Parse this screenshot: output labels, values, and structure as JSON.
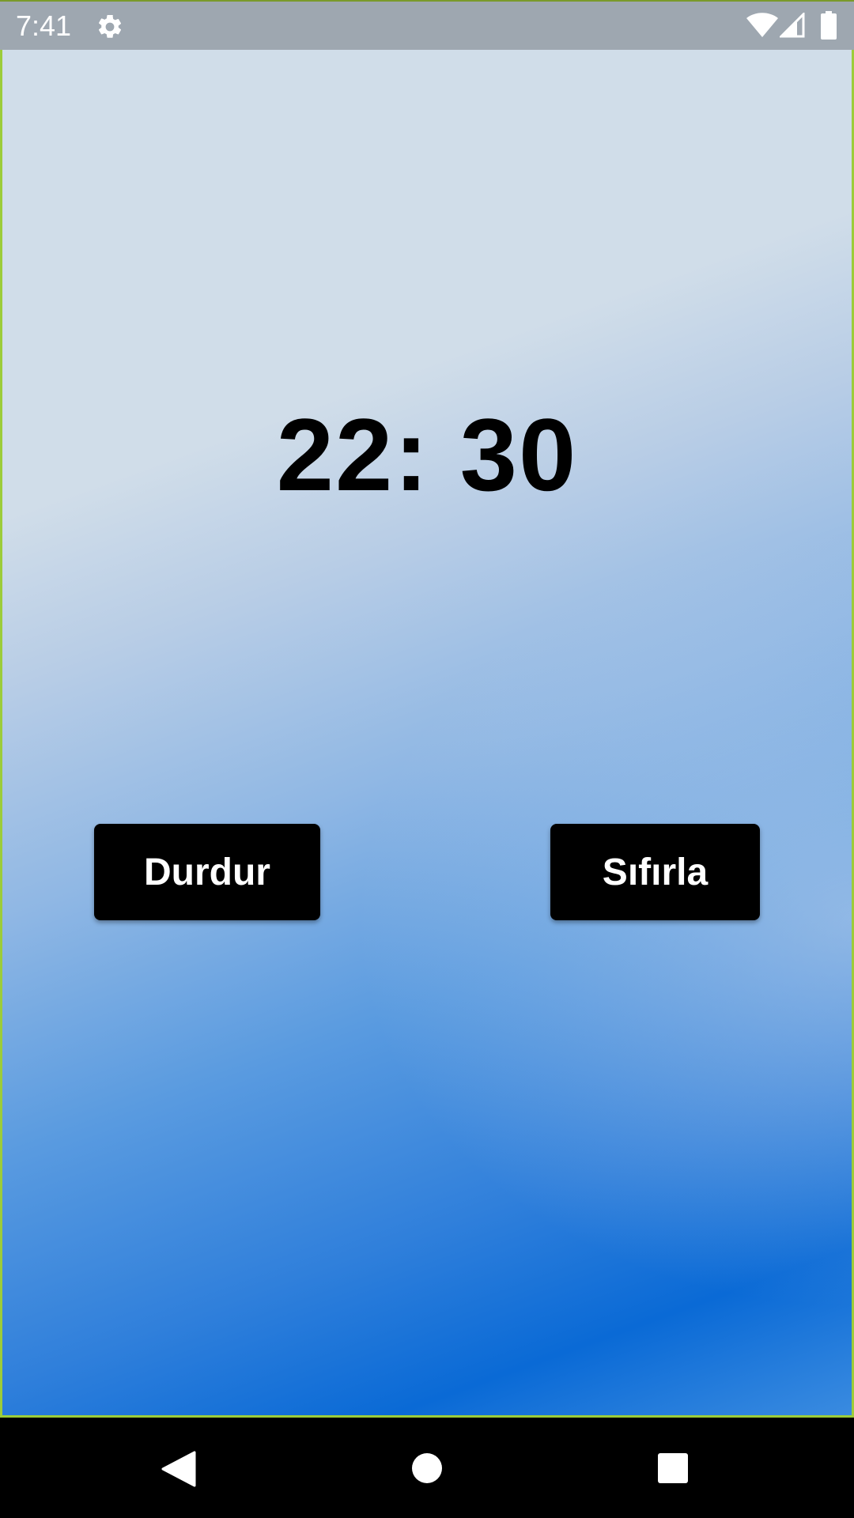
{
  "status_bar": {
    "time": "7:41",
    "icons": [
      "gear-icon",
      "wifi-icon",
      "signal-icon",
      "battery-icon"
    ]
  },
  "timer": {
    "display": "22: 30"
  },
  "buttons": {
    "stop_label": "Durdur",
    "reset_label": "Sıfırla"
  },
  "nav_bar": {
    "icons": [
      "back-icon",
      "home-icon",
      "recents-icon"
    ]
  },
  "colors": {
    "button_bg": "#000000",
    "button_text": "#ffffff",
    "gradient_top": "#d0dde9",
    "gradient_bottom": "#0a6ad6",
    "status_bar_bg": "#9ea7b0",
    "frame_border": "#9ccc3a"
  }
}
